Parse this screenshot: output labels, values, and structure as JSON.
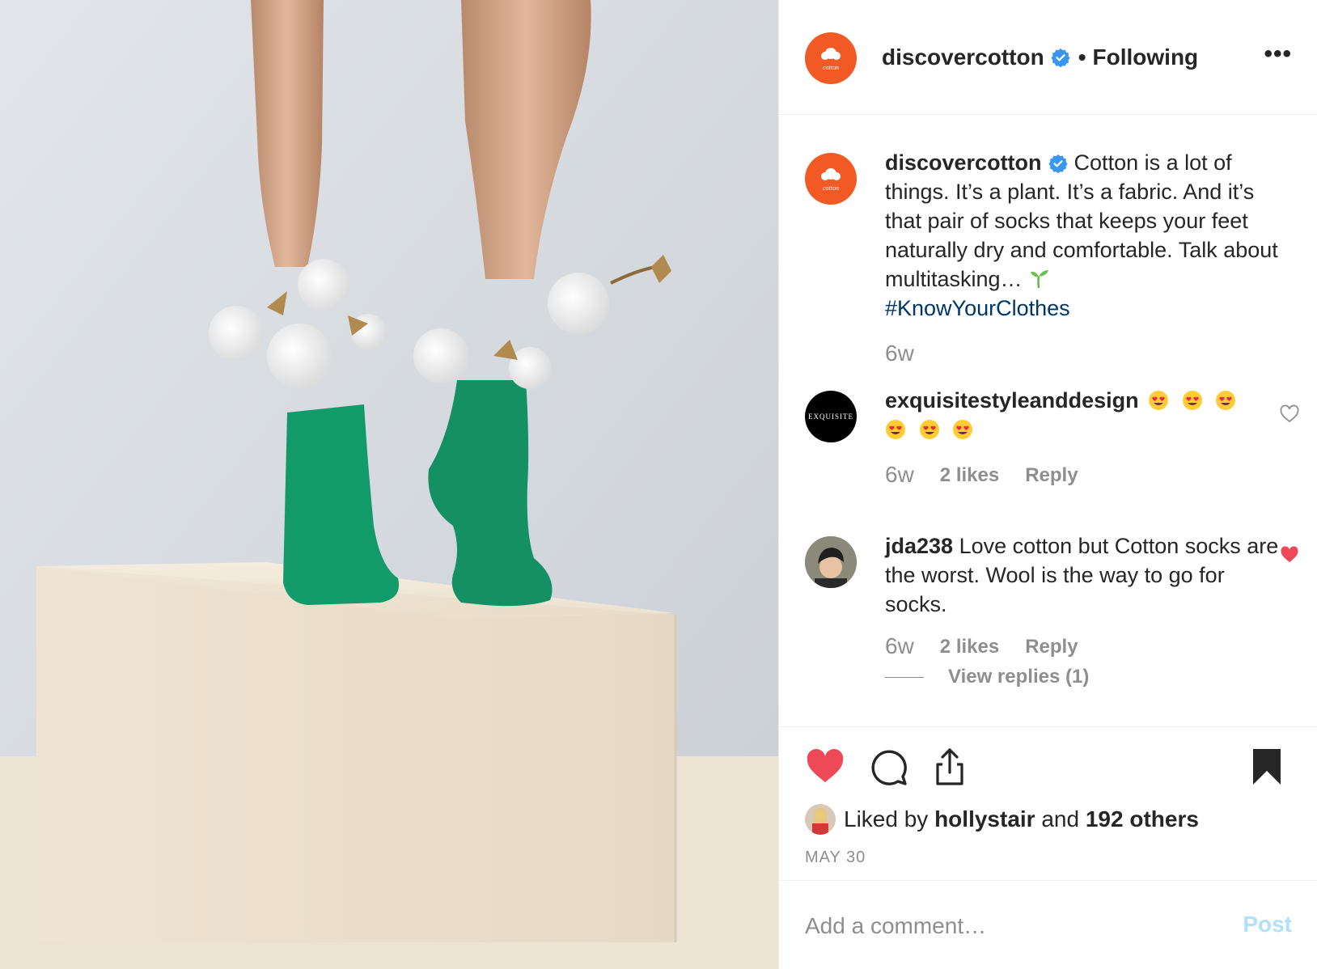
{
  "post": {
    "author": "discovercotton",
    "follow_state": "Following",
    "separator": "•",
    "more_label": "•••"
  },
  "caption": {
    "username": "discovercotton",
    "text": "Cotton is a lot of things. It’s a plant. It’s a fabric. And it’s that pair of socks that keeps your feet naturally dry and comfortable. Talk about multitasking…",
    "hashtag": "#KnowYourClothes",
    "time": "6w"
  },
  "comments": [
    {
      "username": "exquisitestyleanddesign",
      "emoji_count": 6,
      "time": "6w",
      "likes": "2 likes",
      "reply": "Reply",
      "liked": false
    },
    {
      "username": "jda238",
      "text": "Love cotton but Cotton socks are the worst. Wool is the way to go for socks.",
      "time": "6w",
      "likes": "2 likes",
      "reply": "Reply",
      "liked": true,
      "view_replies": "View replies (1)"
    }
  ],
  "engagement": {
    "liked_by_prefix": "Liked by",
    "liked_by_user": "hollystair",
    "and": "and",
    "others": "192 others",
    "date": "MAY 30",
    "liked": true,
    "saved": true
  },
  "comment_box": {
    "placeholder": "Add a comment…",
    "post_label": "Post"
  },
  "avatar_text": {
    "cotton_logo": "cotton",
    "exquisite": "EXQUISITE"
  },
  "colors": {
    "cotton_orange": "#f15a24",
    "like_red": "#ed4956",
    "verified_blue": "#3897f0",
    "hashtag_blue": "#00376b",
    "sock_green": "#139a6b",
    "muted": "#8e8e8e",
    "post_disabled": "#b2dffc"
  }
}
